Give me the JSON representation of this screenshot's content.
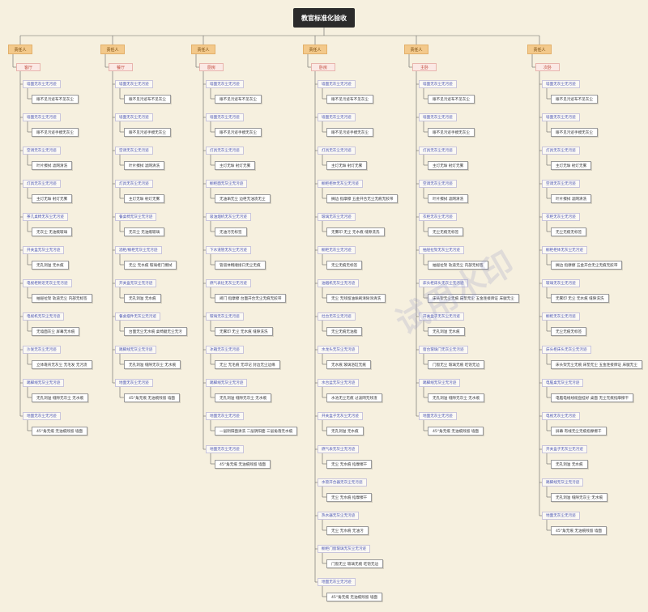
{
  "title": "教官标准化验收",
  "watermark": "试用水印",
  "colors": {
    "owner_bg": "#f3c98b",
    "room_text": "#c24a3b",
    "item_text": "#4a55b3",
    "root_bg": "#2b2b2b"
  },
  "columns": [
    {
      "owner": "责任人",
      "room": "客厅",
      "items": [
        {
          "label": "墙面无灰尘无污迹",
          "detail": "眼不见污迹布不见灰尘"
        },
        {
          "label": "墙面无灰尘无污迹",
          "detail": "眼不见污迹手摸无灰尘"
        },
        {
          "label": "空调无灰尘无污迹",
          "detail": "叶片擦拭 滤网清洗"
        },
        {
          "label": "灯具无灰尘无污迹",
          "detail": "主灯无垢 射灯无雾"
        },
        {
          "label": "茶几桌椅无灰尘无污迹",
          "detail": "无灰尘 无油痕玻璃"
        },
        {
          "label": "开关盒无灰尘无污迹",
          "detail": "无孔洞溢 无水痕"
        },
        {
          "label": "电视柜附近无灰尘无污迹",
          "detail": "抽屉拉架 轨道无尘 内部无标签"
        },
        {
          "label": "电视机无灰尘无污迹",
          "detail": "无墙面灰尘 屏幕无水痕"
        },
        {
          "label": "沙发无灰尘无污迹",
          "detail": "立体靠背无灰尘 无毛发 无污渍"
        },
        {
          "label": "踢脚线无灰尘无污迹",
          "detail": "无孔洞溢 缝隙无灰尘 无水痕"
        },
        {
          "label": "地面无灰尘无污迹",
          "detail": "45°角无痕 无油痕残留 墙面"
        }
      ]
    },
    {
      "owner": "责任人",
      "room": "餐厅",
      "items": [
        {
          "label": "墙面无灰尘无污迹",
          "detail": "眼不见污迹布不见灰尘"
        },
        {
          "label": "墙面无灰尘无污迹",
          "detail": "眼不见污迹手摸无灰尘"
        },
        {
          "label": "空调无灰尘无污迹",
          "detail": "叶片擦拭 滤网清洗"
        },
        {
          "label": "灯具无灰尘无污迹",
          "detail": "主灯无垢 射灯无雾"
        },
        {
          "label": "餐桌椅无灰尘无污迹",
          "detail": "无灰尘 无油痕玻璃"
        },
        {
          "label": "酒柜/橱柜无灰尘无污迹",
          "detail": "无尘 无水痕 玻璃柜门擦拭"
        },
        {
          "label": "开关盒无灰尘无污迹",
          "detail": "无孔洞溢 无水痕"
        },
        {
          "label": "餐桌摆件无灰尘无污迹",
          "detail": "台面无尘无水痕 桌椅腿无尘无污"
        },
        {
          "label": "踢脚线无灰尘无污迹",
          "detail": "无孔洞溢 缝隙无灰尘 无水痕"
        },
        {
          "label": "地面无灰尘无污迹",
          "detail": "45°角无痕 无油痕残留 墙面"
        }
      ]
    },
    {
      "owner": "责任人",
      "room": "厨房",
      "items": [
        {
          "label": "墙面无灰尘无污迹",
          "detail": "眼不见污迹布不见灰尘"
        },
        {
          "label": "墙面无灰尘无污迹",
          "detail": "眼不见污迹手摸无灰尘"
        },
        {
          "label": "灯具无灰尘无污迹",
          "detail": "主灯无垢 射灯无雾"
        },
        {
          "label": "橱柜面无灰尘无污迹",
          "detail": "无油垢无尘 边柜无油渍无尘"
        },
        {
          "label": "吸油烟机无灰尘无污迹",
          "detail": "无油污无标签"
        },
        {
          "label": "下水道管无灰尘无污迹",
          "detail": "管道体畅顺接口无尘无痕"
        },
        {
          "label": "燃气表灶无灰尘无污迹",
          "detail": "阀门 指摩擦 台面开合无尘无痕无胶带"
        },
        {
          "label": "玻璃无灰尘无污迹",
          "detail": "无雾印 无尘 无水痕 缝隙洗洗"
        },
        {
          "label": "冰箱无灰尘无污迹",
          "detail": "无尘 无毛痕 无印记 封边无尘边缘"
        },
        {
          "label": "踢脚线无灰尘无污迹",
          "detail": "无孔洞溢 缝隙无灰尘 无水痕"
        },
        {
          "label": "地面无灰尘无污迹",
          "detail": "一层阴阳面清洗 二层阴阳面 三层角落无水痕"
        },
        {
          "label": "地面无灰尘无污迹",
          "detail": "45°角无痕 无油痕残留 墙面"
        }
      ]
    },
    {
      "owner": "责任人",
      "room": "卧房",
      "items": [
        {
          "label": "墙面无灰尘无污迹",
          "detail": "眼不见污迹布不见灰尘"
        },
        {
          "label": "墙面无灰尘无污迹",
          "detail": "眼不见污迹手摸无灰尘"
        },
        {
          "label": "灯具无灰尘无污迹",
          "detail": "主灯无垢 射灯无雾"
        },
        {
          "label": "橱柜柜体无灰尘无污迹",
          "detail": "搁边 指摩擦 五金开合无尘无痕无胶带"
        },
        {
          "label": "玻璃无灰尘无污迹",
          "detail": "无雾印 无尘 无水痕 缝隙洗洗"
        },
        {
          "label": "橱柜无灰尘无污迹",
          "detail": "无尘无痕无标签"
        },
        {
          "label": "油烟机无灰尘无污迹",
          "detail": "无尘 无残留油垢刷清除涂清洗"
        },
        {
          "label": "灶台无灰尘无污迹",
          "detail": "无尘无痕无油脂"
        },
        {
          "label": "水龙头无灰尘无污迹",
          "detail": "无水痕 玻璃浴缸无痕"
        },
        {
          "label": "水台盆无灰尘无污迹",
          "detail": "水池无尘无痕 过滤网无残渣"
        },
        {
          "label": "开关盒子无灰尘无污迹",
          "detail": "无孔洞溢 无水痕"
        },
        {
          "label": "燃气表无灰尘无污迹",
          "detail": "无尘 无水痕 指摩擦干"
        },
        {
          "label": "水管开合器无灰尘无污迹",
          "detail": "无尘 无水痕 指摩擦干"
        },
        {
          "label": "热水器无灰尘无污迹",
          "detail": "无尘 无水痕 无油污"
        },
        {
          "label": "橱柜门窗玻璃无灰尘无污迹",
          "detail": "门窗无尘 玻璃无痕 吃饱无边"
        },
        {
          "label": "地面无灰尘无污迹",
          "detail": "45°角无痕 无油痕残留 墙面"
        }
      ]
    },
    {
      "owner": "责任人",
      "room": "主卧",
      "items": [
        {
          "label": "墙面无灰尘无污迹",
          "detail": "眼不见污迹布不见灰尘"
        },
        {
          "label": "墙面无灰尘无污迹",
          "detail": "眼不见污迹手摸无灰尘"
        },
        {
          "label": "灯具无灰尘无污迹",
          "detail": "主灯无垢 射灯无雾"
        },
        {
          "label": "空调无灰尘无污迹",
          "detail": "叶片擦拭 滤网清洗"
        },
        {
          "label": "衣柜无灰尘无污迹",
          "detail": "无尘无痕无标签"
        },
        {
          "label": "抽屉拉架无灰尘无污迹",
          "detail": "抽屉拉架 轨道无尘 内部无标签"
        },
        {
          "label": "床头柜床头无灰尘无污迹",
          "detail": "床头架无尘无痕 床垫无尘 五金连接牌证 床腿无尘"
        },
        {
          "label": "开关盒子无灰尘无污迹",
          "detail": "无孔洞溢 无水痕"
        },
        {
          "label": "窗台玻璃门无灰尘无污迹",
          "detail": "门窗无尘 玻璃无痕 吃饱无边"
        },
        {
          "label": "踢脚线无灰尘无污迹",
          "detail": "无孔洞溢 缝隙无灰尘 无水痕"
        },
        {
          "label": "地面无灰尘无污迹",
          "detail": "45°角无痕 无油痕残留 墙面"
        }
      ]
    },
    {
      "owner": "责任人",
      "room": "次卧",
      "items": [
        {
          "label": "墙面无灰尘无污迹",
          "detail": "眼不见污迹布不见灰尘"
        },
        {
          "label": "墙面无灰尘无污迹",
          "detail": "眼不见污迹手摸无灰尘"
        },
        {
          "label": "灯具无灰尘无污迹",
          "detail": "主灯无垢 射灯无雾"
        },
        {
          "label": "空调无灰尘无污迹",
          "detail": "叶片擦拭 滤网清洗"
        },
        {
          "label": "衣柜无灰尘无污迹",
          "detail": "无尘无痕无标签"
        },
        {
          "label": "橱柜柜体无灰尘无污迹",
          "detail": "搁边 指摩擦 五金开合无尘无痕无胶带"
        },
        {
          "label": "玻璃无灰尘无污迹",
          "detail": "无雾印 无尘 无水痕 缝隙洗洗"
        },
        {
          "label": "橱柜无灰尘无污迹",
          "detail": "无尘无痕无标签"
        },
        {
          "label": "床头柜床头无灰尘无污迹",
          "detail": "床头架无尘无痕 床垫无尘 五金连接牌证 床腿无尘"
        },
        {
          "label": "电脑桌无灰尘无污迹",
          "detail": "电脑电线线缆盘挂好 桌面 无尘无痕指摩擦干"
        },
        {
          "label": "电视无灰尘无污迹",
          "detail": "屏幕 有线无尘无痕指摩擦干"
        },
        {
          "label": "开关盒子无灰尘无污迹",
          "detail": "无孔洞溢 无水痕"
        },
        {
          "label": "踢脚线无灰尘无污迹",
          "detail": "无孔洞溢 缝隙无灰尘 无水痕"
        },
        {
          "label": "地面无灰尘无污迹",
          "detail": "45°角无痕 无油痕残留 墙面"
        }
      ]
    }
  ]
}
